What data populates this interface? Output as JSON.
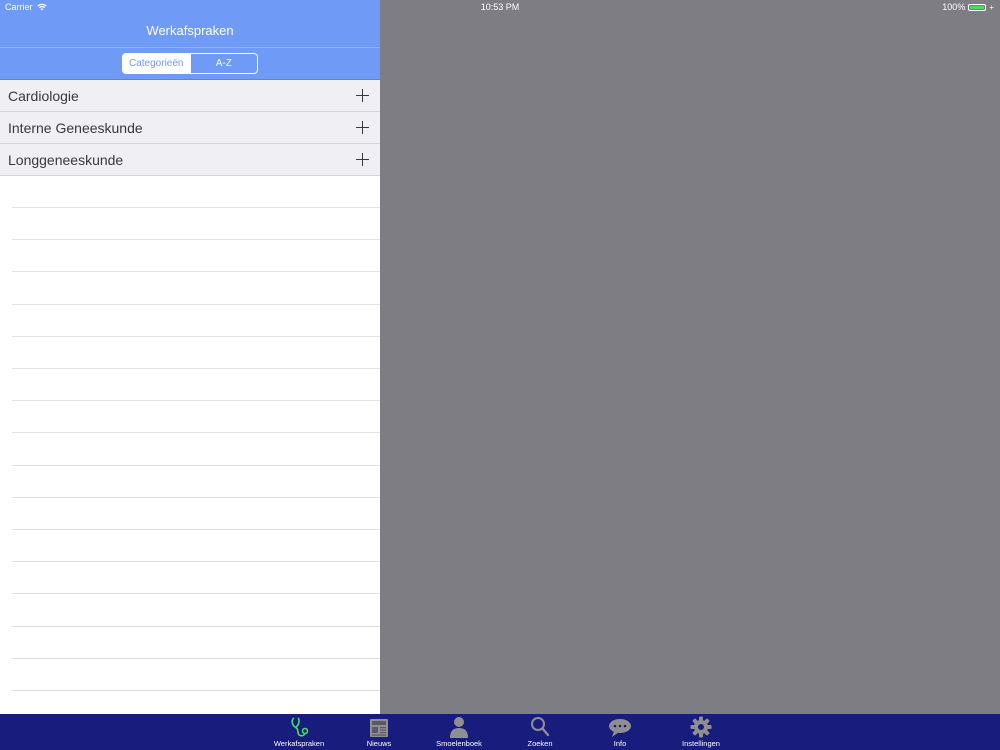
{
  "status": {
    "carrier": "Carrier",
    "time": "10:53 PM",
    "battery": "100%",
    "battery_level": 1.0
  },
  "navbar": {
    "title": "Werkafspraken"
  },
  "segments": [
    {
      "label": "Categorieën",
      "selected": true
    },
    {
      "label": "A-Z",
      "selected": false
    }
  ],
  "categories": [
    {
      "label": "Cardiologie"
    },
    {
      "label": "Interne Geneeskunde"
    },
    {
      "label": "Longgeneeskunde"
    }
  ],
  "tabs": [
    {
      "label": "Werkafspraken",
      "icon": "stethoscope-icon",
      "active": true
    },
    {
      "label": "Nieuws",
      "icon": "newspaper-icon"
    },
    {
      "label": "Smoelenboek",
      "icon": "person-icon"
    },
    {
      "label": "Zoeken",
      "icon": "search-icon"
    },
    {
      "label": "Info",
      "icon": "chat-bubble-icon"
    },
    {
      "label": "Instellingen",
      "icon": "gear-icon"
    }
  ],
  "colors": {
    "accent": "#6f9bf6",
    "tabbar": "#171c7d",
    "active_tab": "#4cd964",
    "inactive_tab": "#8e8e93"
  }
}
